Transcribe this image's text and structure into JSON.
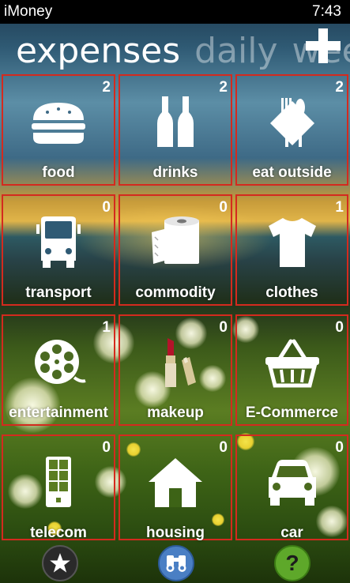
{
  "status": {
    "app_name": "iMoney",
    "time": "7:43"
  },
  "pivot": {
    "active": "expenses",
    "next": "daily",
    "partial": "weekl"
  },
  "tiles": [
    {
      "label": "food",
      "count": "2",
      "icon": "burger-icon"
    },
    {
      "label": "drinks",
      "count": "2",
      "icon": "bottles-icon"
    },
    {
      "label": "eat outside",
      "count": "2",
      "icon": "cutlery-icon"
    },
    {
      "label": "transport",
      "count": "0",
      "icon": "bus-icon"
    },
    {
      "label": "commodity",
      "count": "0",
      "icon": "toilet-paper-icon"
    },
    {
      "label": "clothes",
      "count": "1",
      "icon": "tshirt-icon"
    },
    {
      "label": "entertainment",
      "count": "1",
      "icon": "film-reel-icon"
    },
    {
      "label": "makeup",
      "count": "0",
      "icon": "lipstick-icon"
    },
    {
      "label": "E-Commerce",
      "count": "0",
      "icon": "basket-icon"
    },
    {
      "label": "telecom",
      "count": "0",
      "icon": "phone-icon"
    },
    {
      "label": "housing",
      "count": "0",
      "icon": "house-icon"
    },
    {
      "label": "car",
      "count": "0",
      "icon": "car-icon"
    }
  ],
  "appbar": {
    "buttons": [
      "star-icon",
      "binoculars-icon",
      "help-icon"
    ],
    "help_glyph": "?"
  },
  "colors": {
    "tile_border": "#d42a1e",
    "statusbar": "#000000",
    "help": "#5ea82a",
    "binoculars": "#4a7fc4"
  }
}
